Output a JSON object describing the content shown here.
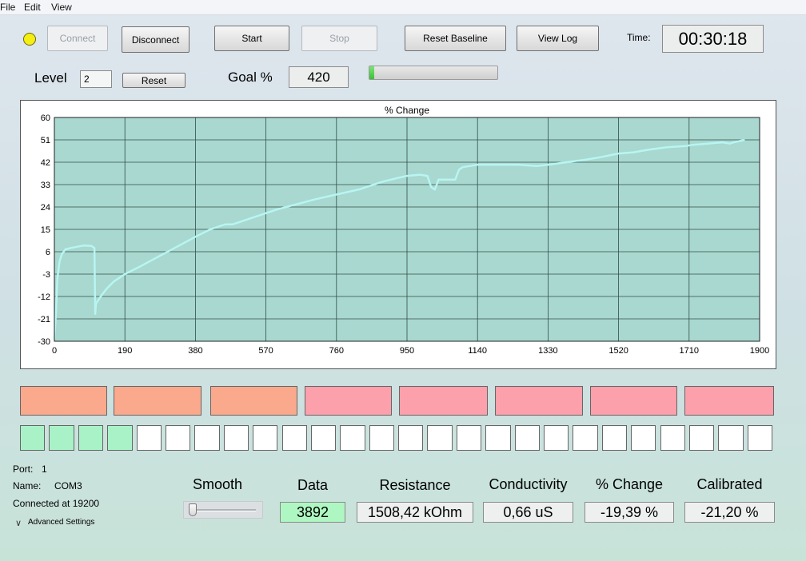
{
  "menu": {
    "file": "File",
    "edit": "Edit",
    "view": "View"
  },
  "toolbar": {
    "connect": "Connect",
    "disconnect": "Disconnect",
    "start": "Start",
    "stop": "Stop",
    "reset_baseline": "Reset Baseline",
    "view_log": "View Log",
    "time_label": "Time:",
    "time_value": "00:30:18"
  },
  "level": {
    "label": "Level",
    "value": "2",
    "reset": "Reset"
  },
  "goal": {
    "label": "Goal %",
    "value": "420"
  },
  "progress": {
    "fraction": 0.04
  },
  "chart_data": {
    "type": "line",
    "title": "% Change",
    "xlabel": "",
    "ylabel": "",
    "xlim": [
      0,
      1900
    ],
    "ylim": [
      -30,
      60
    ],
    "x_ticks": [
      0,
      190,
      380,
      570,
      760,
      950,
      1140,
      1330,
      1520,
      1710,
      1900
    ],
    "y_ticks": [
      60,
      51,
      42,
      33,
      24,
      15,
      6,
      -3,
      -12,
      -21,
      -30
    ],
    "grid": true,
    "background": "#a8d8cf",
    "line_color": "#b8f5f2",
    "series": [
      {
        "x": [
          0,
          4,
          8,
          14,
          20,
          30,
          45,
          60,
          80,
          100,
          108,
          110,
          112,
          116,
          125,
          140,
          160,
          190,
          230,
          280,
          330,
          380,
          420,
          460,
          480,
          500,
          520,
          560,
          600,
          650,
          700,
          760,
          820,
          880,
          920,
          950,
          985,
          1005,
          1015,
          1025,
          1035,
          1060,
          1080,
          1090,
          1100,
          1140,
          1190,
          1250,
          1300,
          1330,
          1380,
          1430,
          1470,
          1520,
          1560,
          1600,
          1650,
          1700,
          1720,
          1760,
          1800,
          1820,
          1830,
          1860
        ],
        "y": [
          -29,
          -19,
          -5,
          2,
          5,
          7,
          7.5,
          8,
          8.5,
          8.3,
          7.5,
          -19,
          -15,
          -14,
          -12,
          -9,
          -6,
          -3,
          0,
          4,
          8,
          12,
          15,
          17,
          17,
          18,
          19,
          21,
          23,
          25,
          27,
          29,
          31,
          34,
          35.5,
          36.5,
          37,
          36.5,
          32,
          31,
          35,
          35,
          35,
          39,
          40,
          41,
          41,
          41,
          40.5,
          41,
          42,
          43,
          44,
          45.5,
          46,
          47,
          48,
          48.5,
          49,
          49.5,
          50,
          49.5,
          50,
          51
        ]
      }
    ]
  },
  "indicators": {
    "colors": [
      "#fba98c",
      "#fba98c",
      "#fba98c",
      "#fca0ab",
      "#fca0ab",
      "#fca0ab",
      "#fca0ab",
      "#fca0ab"
    ]
  },
  "level_cells": {
    "filled": 4,
    "total": 26,
    "fill_color": "#a9f2c8",
    "empty_color": "#ffffff"
  },
  "port_info": {
    "port_label": "Port:",
    "port_value": "1",
    "name_label": "Name:",
    "name_value": "COM3",
    "connected": "Connected at 19200",
    "advanced": "Advanced Settings"
  },
  "readouts": {
    "smooth_label": "Smooth",
    "data_label": "Data",
    "data_value": "3892",
    "data_color": "#aef7c2",
    "resistance_label": "Resistance",
    "resistance_value": "1508,42 kOhm",
    "conductivity_label": "Conductivity",
    "conductivity_value": "0,66 uS",
    "pct_label": "% Change",
    "pct_value": "-19,39 %",
    "calibrated_label": "Calibrated",
    "calibrated_value": "-21,20 %"
  }
}
